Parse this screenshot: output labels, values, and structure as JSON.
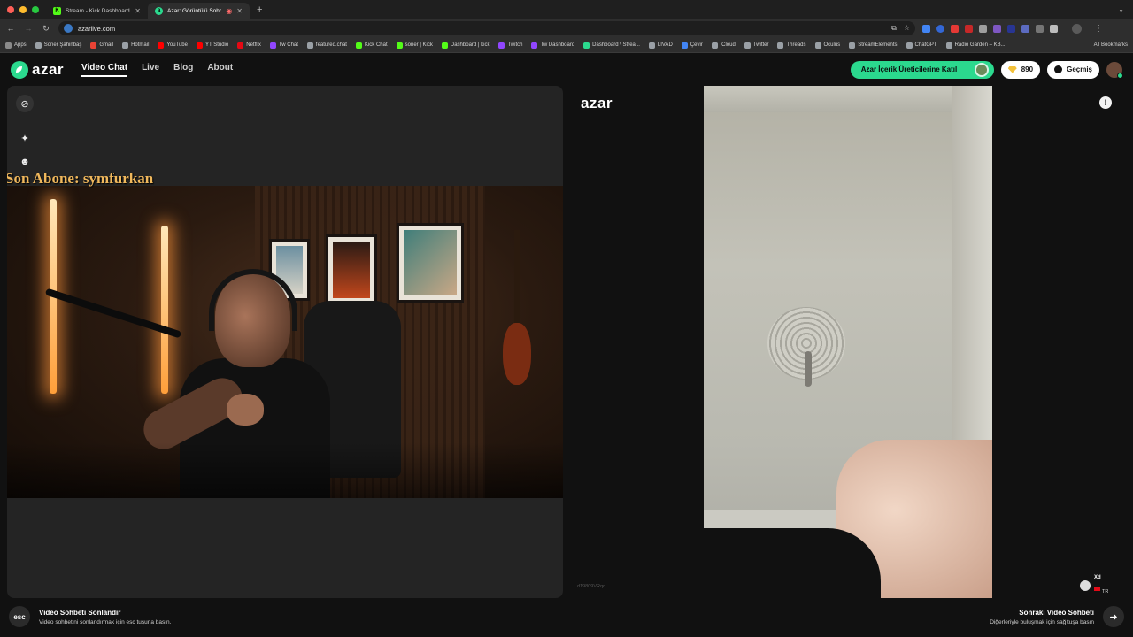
{
  "browser": {
    "tabs": [
      {
        "title": "Stream - Kick Dashboard",
        "favicon": "kick-icon",
        "color": "#53fc18"
      },
      {
        "title": "Azar: Görüntülü Sohbet, /",
        "favicon": "azar-icon",
        "color": "#2bd98e",
        "active": true
      }
    ],
    "new_tab_label": "+",
    "url": "azarlive.com",
    "bookmarks": [
      {
        "label": "Apps",
        "color": "#8a8a8a"
      },
      {
        "label": "Soner Şahinbaş",
        "color": "#9aa0a6"
      },
      {
        "label": "Gmail",
        "color": "#ea4335"
      },
      {
        "label": "Hotmail",
        "color": "#9aa0a6"
      },
      {
        "label": "YouTube",
        "color": "#ff0000"
      },
      {
        "label": "YT Studio",
        "color": "#ff0000"
      },
      {
        "label": "Netflix",
        "color": "#e50914"
      },
      {
        "label": "Tw Chat",
        "color": "#9146ff"
      },
      {
        "label": "featured.chat",
        "color": "#9aa0a6"
      },
      {
        "label": "Kick Chat",
        "color": "#53fc18"
      },
      {
        "label": "soner | Kick",
        "color": "#53fc18"
      },
      {
        "label": "Dashboard | kick",
        "color": "#53fc18"
      },
      {
        "label": "Twitch",
        "color": "#9146ff"
      },
      {
        "label": "Tw Dashboard",
        "color": "#9146ff"
      },
      {
        "label": "Dashboard / Strea...",
        "color": "#2bd98e"
      },
      {
        "label": "LIVAD",
        "color": "#9aa0a6"
      },
      {
        "label": "Çevir",
        "color": "#4285f4"
      },
      {
        "label": "iCloud",
        "color": "#9aa0a6"
      },
      {
        "label": "Twitter",
        "color": "#9aa0a6"
      },
      {
        "label": "Threads",
        "color": "#9aa0a6"
      },
      {
        "label": "Oculus",
        "color": "#9aa0a6"
      },
      {
        "label": "StreamElements",
        "color": "#9aa0a6"
      },
      {
        "label": "ChatGPT",
        "color": "#9aa0a6"
      },
      {
        "label": "Radio Garden – KB...",
        "color": "#9aa0a6"
      }
    ],
    "all_bookmarks": "All Bookmarks"
  },
  "header": {
    "logo_text": "azar",
    "nav": [
      {
        "label": "Video Chat",
        "active": true
      },
      {
        "label": "Live"
      },
      {
        "label": "Blog"
      },
      {
        "label": "About"
      }
    ],
    "creator_cta": "Azar İçerik Üreticilerine Katıl",
    "gems": "890",
    "history": "Geçmiş"
  },
  "left": {
    "overlay_text": "Son Abone: symfurkan"
  },
  "right": {
    "watermark": "azar",
    "session_id": "d19809VRqo",
    "peer_name": "Xd",
    "peer_country": "TR"
  },
  "footer": {
    "esc_key": "esc",
    "end_title": "Video Sohbeti Sonlandır",
    "end_desc": "Video sohbetini sonlandırmak için esc tuşuna basın.",
    "next_title": "Sonraki Video Sohbeti",
    "next_desc": "Diğerleriyle buluşmak için sağ tuşa basın",
    "next_icon": "arrow-right-icon"
  },
  "colors": {
    "brand": "#2bd98e",
    "overlay_text": "#f0b85c",
    "background": "#111111"
  }
}
